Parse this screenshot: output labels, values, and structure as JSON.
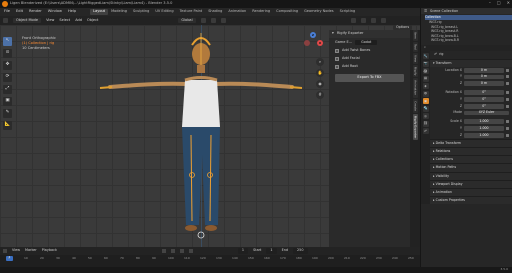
{
  "window_title": "Ligen Blenderized (E:\\Users\\ADMIN\\...\\LightRiggedLiam\\Stinky\\Liam\\Liam4) - Blender 3.5.0",
  "menu": [
    "File",
    "Edit",
    "Render",
    "Window",
    "Help"
  ],
  "workspace_tabs": [
    "Layout",
    "Modeling",
    "Sculpting",
    "UV Editing",
    "Texture Paint",
    "Shading",
    "Animation",
    "Rendering",
    "Compositing",
    "Geometry Nodes",
    "Scripting"
  ],
  "active_tab": "Layout",
  "scene_label": "Scene",
  "view_layer_label": "ViewLayer",
  "viewport_header": {
    "mode": "Object Mode",
    "items": [
      "View",
      "Select",
      "Add",
      "Object"
    ],
    "orientation": "Global",
    "options_label": "Options"
  },
  "view_info": {
    "line1": "Front Orthographic",
    "line2": "(1) Collection | rig",
    "line3": "10 Centimeters"
  },
  "tools": [
    "↖",
    "⊙",
    "✥",
    "⟳",
    "⤢",
    "▣",
    "✎",
    "📐"
  ],
  "gizmo": {
    "x": "X",
    "y": "Y",
    "z": "Z",
    "colors": {
      "x": "#e04848",
      "y": "#78b83a",
      "z": "#4a7fd6"
    }
  },
  "rigify_panel": {
    "title": "Rigify Exporter",
    "game_engine_label": "Game E...",
    "game_engine_value": "Godot",
    "options": [
      "Add Twist Bones",
      "Add Facial",
      "Add Root"
    ],
    "export_button": "Export To FBX"
  },
  "side_tabs": [
    "Item",
    "Tool",
    "View",
    "Rigify",
    "Animation",
    "Create",
    "Rigify Exporter"
  ],
  "outliner": {
    "header": "Scene Collection",
    "items": [
      "Collection",
      "WGT-rig",
      "WGT-rig_breast.L",
      "WGT-rig_breast.R",
      "WGT-rig_brow.B.L",
      "WGT-rig_brow.B.R"
    ],
    "selected_index": 0
  },
  "properties": {
    "object_name": "rig",
    "sections": {
      "transform": "Transform",
      "location": "Location X",
      "rotation": "Rotation X",
      "mode_label": "Mode",
      "mode_value": "XYZ Euler",
      "scale": "Scale X"
    },
    "location": [
      "0 m",
      "0 m",
      "0 m"
    ],
    "rotation": [
      "0°",
      "0°",
      "0°"
    ],
    "scale": [
      "1.000",
      "1.000",
      "1.000"
    ],
    "axes": [
      "X",
      "Y",
      "Z"
    ],
    "more_sections": [
      "Delta Transform",
      "Relations",
      "Collections",
      "Motion Paths",
      "Visibility",
      "Viewport Display",
      "Animation",
      "Custom Properties"
    ]
  },
  "timeline": {
    "items": [
      "View",
      "Marker",
      "Playback"
    ],
    "current_frame": "1",
    "start_label": "Start",
    "start": "1",
    "end_label": "End",
    "end": "250",
    "ticks": [
      "0",
      "10",
      "20",
      "30",
      "40",
      "50",
      "60",
      "70",
      "80",
      "90",
      "100",
      "110",
      "120",
      "130",
      "140",
      "150",
      "160",
      "170",
      "180",
      "190",
      "200",
      "210",
      "220",
      "230",
      "240",
      "250"
    ]
  },
  "status": {
    "version": "3.5.0"
  }
}
